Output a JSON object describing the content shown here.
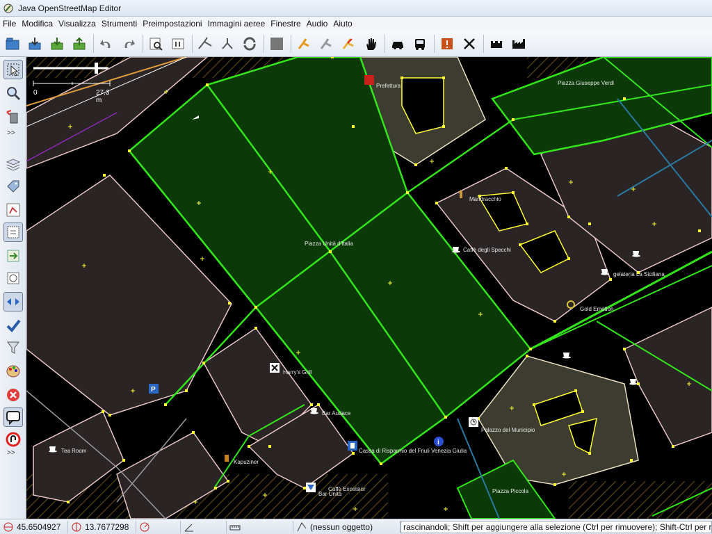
{
  "window": {
    "title": "Java OpenStreetMap Editor"
  },
  "menu": [
    "File",
    "Modifica",
    "Visualizza",
    "Strumenti",
    "Preimpostazioni",
    "Immagini aeree",
    "Finestre",
    "Audio",
    "Aiuto"
  ],
  "toolbar": {
    "buttons": [
      "open-file-icon",
      "download-icon",
      "download-data-icon",
      "upload-icon",
      "undo-icon",
      "redo-icon",
      "preferences-icon",
      "info-icon",
      "split-way-icon",
      "combine-way-icon",
      "reverse-way-icon",
      "layer-icon",
      "walking-icon",
      "hiking-icon",
      "cycling-icon",
      "hand-icon",
      "car-icon",
      "bus-icon",
      "warning-icon",
      "cross-icon",
      "castle-icon",
      "factory-icon"
    ]
  },
  "left_toolbar": {
    "more_label": ">>",
    "more_label_bottom": ">>"
  },
  "map": {
    "scale": {
      "start": "0",
      "end": "27.3 m"
    },
    "labels": {
      "prefettura": "Prefettura",
      "piazza_verdi": "Piazza Giuseppe Verdi",
      "mandracchio": "Mandracchio",
      "piazza_unita": "Piazza Unità d'Italia",
      "caffe_specchi": "Caffè degli Specchi",
      "gelateria": "gelateria La Siciliana",
      "gold_emotion": "Gold Emotion",
      "harrys_grill": "Harry's Grill",
      "bar_audace": "Bar Audace",
      "palazzo_municipio": "Palazzo del Municipio",
      "cassa_risparmio": "Cassa di Risparmio del Friuli Venezia Giulia",
      "tea_room": "Tea Room",
      "kapuziner": "Kapuziner",
      "caffe_excelsior": "Caffè Excelsior",
      "bar_unita": "Bar Unità",
      "piazza_piccola": "Piazza Piccola"
    },
    "colors": {
      "background": "#000000",
      "building_fill": "#2b2424",
      "building_outline": "#e8c6c6",
      "piazza_fill": "#0b3a08",
      "way_green": "#33e61a",
      "node_yellow": "#ffff33",
      "pedestrian_fill": "#3c3c30",
      "road_gray": "#9a9aa0",
      "hatch": "#3a2d10"
    }
  },
  "status": {
    "lat": "45.6504927",
    "lon": "13.7677298",
    "selection": "(nessun oggetto)",
    "help_text": "rascinandoli; Shift per aggiungere alla selezione (Ctrl per rimuovere); Shift-Ctrl per r"
  }
}
